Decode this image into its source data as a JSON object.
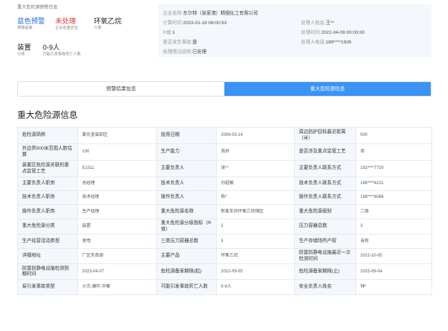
{
  "header": {
    "title": "重大危险源预警信息"
  },
  "stats": [
    {
      "value": "蓝色预警",
      "label": "预警结果"
    },
    {
      "value": "未处理",
      "label": "企业处置状态"
    },
    {
      "value": "环氧乙烷",
      "label": "介质"
    },
    {
      "value": "装置",
      "label": "分类"
    },
    {
      "value": "0-9人",
      "label": "可能引发事故死亡人数"
    }
  ],
  "colors": {
    "accent": "#3a93f5",
    "warning_blue": "#1f6fe0",
    "status_red": "#e0382e"
  },
  "info": {
    "left": [
      {
        "label": "企业名称:",
        "value": "东尔特（张家港）精细化工有限公司"
      },
      {
        "label": "计算时间:",
        "value": "2023-01-18 06:00:53"
      },
      {
        "label": "R值:",
        "value": "1"
      },
      {
        "label": "是否发生事故:",
        "value": "是"
      },
      {
        "label": "处理情况说明:",
        "value": "已处理"
      }
    ],
    "right": [
      {
        "label": "处理人姓名:",
        "value": "王**"
      },
      {
        "label": "处理时间:",
        "value": "2022-04-09 00:00:00"
      },
      {
        "label": "处理人电话:",
        "value": "189****1926"
      }
    ]
  },
  "tabs": [
    {
      "label": "预警结果信息",
      "active": false
    },
    {
      "label": "重大危险源信息",
      "active": true
    }
  ],
  "section_title": "重大危险源信息",
  "table": {
    "rows": [
      [
        "危险源简称",
        "氯化釜装卸区",
        "投用日期",
        "2008-03-14",
        "周边防护目标最近距离（米）",
        "500"
      ],
      [
        "外边界500米范围人数估算",
        "100",
        "生产能力",
        "良好",
        "是否涉及重点监管工艺",
        "否"
      ],
      [
        "装置区危险源关联的重点监管工艺",
        "E1511",
        "主要负责人",
        "张**",
        "主要负责人联系方式",
        "192****7720"
      ],
      [
        "主要负责人职务",
        "总经理",
        "技术负责人",
        "孙超敏",
        "技术负责人联系方式",
        "189****8221"
      ],
      [
        "技术负责人职务",
        "技术经理",
        "操作负责人",
        "杨*",
        "操作负责人联系方式",
        "189****8066"
      ],
      [
        "操作负责人职务",
        "生产经理",
        "重大危险源名称",
        "新氯车间环氧乙烷储区",
        "重大危险源级别",
        "二级"
      ],
      [
        "重大危险源分类",
        "装置",
        "重大危险源分级指标（R值）",
        "2",
        "压力容器总数",
        "3"
      ],
      [
        "生产经营活动类型",
        "使用",
        "三类压力容器总数",
        "3",
        "生产存储场所产权",
        "自有"
      ],
      [
        "详细地址",
        "厂区东南部",
        "主要产品",
        "环氧乙烷",
        "防雷防静电设施最近一次检测时间",
        "2022-10-05"
      ],
      [
        "防雷防静电设施检测到期时间",
        "2023-04-07",
        "危险源备案期限(起)",
        "2022-09-05",
        "危险源备案期限(止)",
        "2025-09-04"
      ],
      [
        "易引发事故类型",
        "火灾,爆炸,中毒",
        "可能引发事故死亡人数",
        "0-9人",
        "安全负责人姓名",
        "钟*"
      ]
    ]
  }
}
